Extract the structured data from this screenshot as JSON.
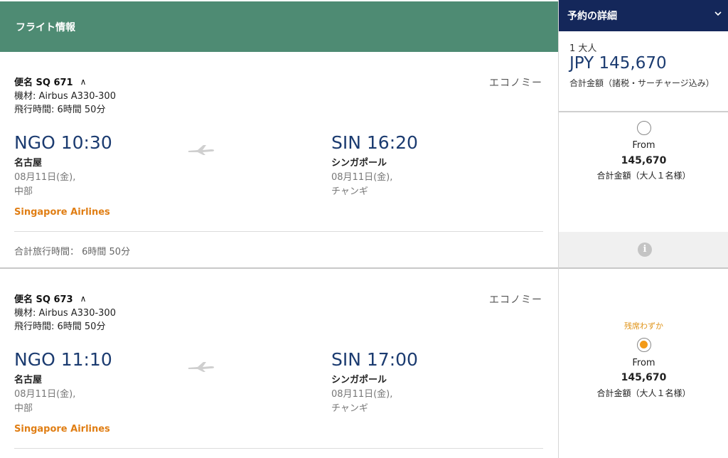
{
  "section_title": "フライト情報",
  "cabin_label": "エコノミー",
  "flights": [
    {
      "flight_no": "便名 SQ 671",
      "aircraft": "機材: Airbus A330-300",
      "duration": "飛行時間: 6時間 50分",
      "dep_time": "NGO 10:30",
      "dep_city": "名古屋",
      "dep_date": "08月11日(金),",
      "dep_terminal": "中部",
      "arr_time": "SIN 16:20",
      "arr_city": "シンガポール",
      "arr_date": "08月11日(金),",
      "arr_terminal": "チャンギ",
      "airline": "Singapore Airlines",
      "total_travel": "合計旅行時間： 6時間 50分"
    },
    {
      "flight_no": "便名 SQ 673",
      "aircraft": "機材: Airbus A330-300",
      "duration": "飛行時間: 6時間 50分",
      "dep_time": "NGO 11:10",
      "dep_city": "名古屋",
      "dep_date": "08月11日(金),",
      "dep_terminal": "中部",
      "arr_time": "SIN 17:00",
      "arr_city": "シンガポール",
      "arr_date": "08月11日(金),",
      "arr_terminal": "チャンギ",
      "airline": "Singapore Airlines"
    }
  ],
  "booking": {
    "header": "予約の詳細",
    "passengers": "1 大人",
    "price": "JPY 145,670",
    "price_note": "合計金額（諸税・サーチャージ込み）"
  },
  "fares": [
    {
      "from": "From",
      "price": "145,670",
      "note": "合計金額（大人１名様）",
      "selected": false
    },
    {
      "seats_left": "残席わずか",
      "from": "From",
      "price": "145,670",
      "note": "合計金額（大人１名様）",
      "selected": true
    }
  ],
  "info_icon_glyph": "i",
  "colors": {
    "header_green": "#4e8b73",
    "booking_navy": "#14275a",
    "time_blue": "#1b3b70",
    "airline_orange": "#e07e14",
    "radio_orange": "#f39a17"
  }
}
